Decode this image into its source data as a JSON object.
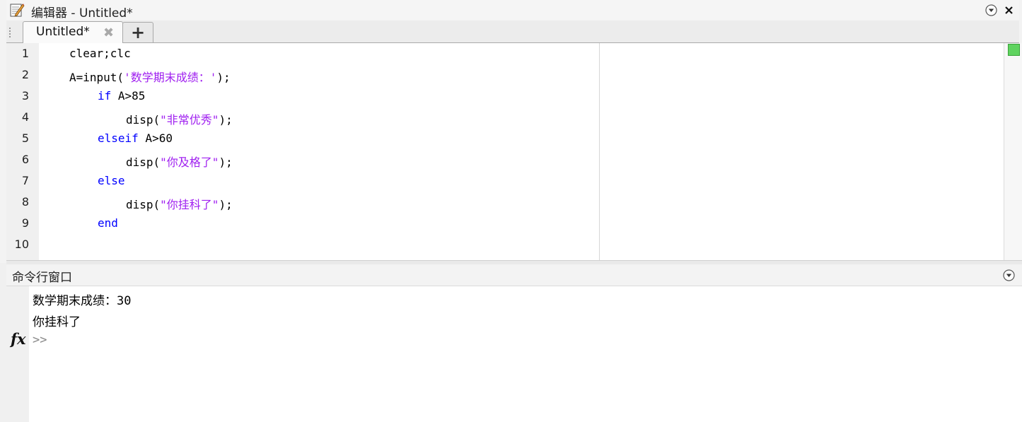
{
  "editor": {
    "title": "编辑器 - Untitled*",
    "title_icon": "edit-pencil-icon",
    "tabs": [
      {
        "label": "Untitled*"
      }
    ],
    "add_tab_label": "+",
    "close_tab_glyph": "✖",
    "status_color": "#5fd35f",
    "line_numbers": [
      "1",
      "2",
      "3",
      "4",
      "5",
      "6",
      "7",
      "8",
      "9",
      "10"
    ],
    "code": {
      "l1": {
        "text": "clear;clc"
      },
      "l2": {
        "a": "A=input(",
        "s": "'数学期末成绩：'",
        "b": ");"
      },
      "l3": {
        "kw": "if",
        "rest": " A>85"
      },
      "l4": {
        "a": "disp(",
        "s": "\"非常优秀\"",
        "b": ");"
      },
      "l5": {
        "kw": "elseif",
        "rest": " A>60"
      },
      "l6": {
        "a": "disp(",
        "s": "\"你及格了\"",
        "b": ");"
      },
      "l7": {
        "kw": "else"
      },
      "l8": {
        "a": "disp(",
        "s": "\"你挂科了\"",
        "b": ");"
      },
      "l9": {
        "kw": "end"
      }
    }
  },
  "command_window": {
    "title": "命令行窗口",
    "menu_icon": "chevron-down-circle-icon",
    "output": [
      "数学期末成绩：30",
      "你挂科了"
    ],
    "prompt": ">>",
    "fx_label": "fx"
  },
  "colors": {
    "keyword": "#0000ff",
    "string": "#a020f0"
  }
}
